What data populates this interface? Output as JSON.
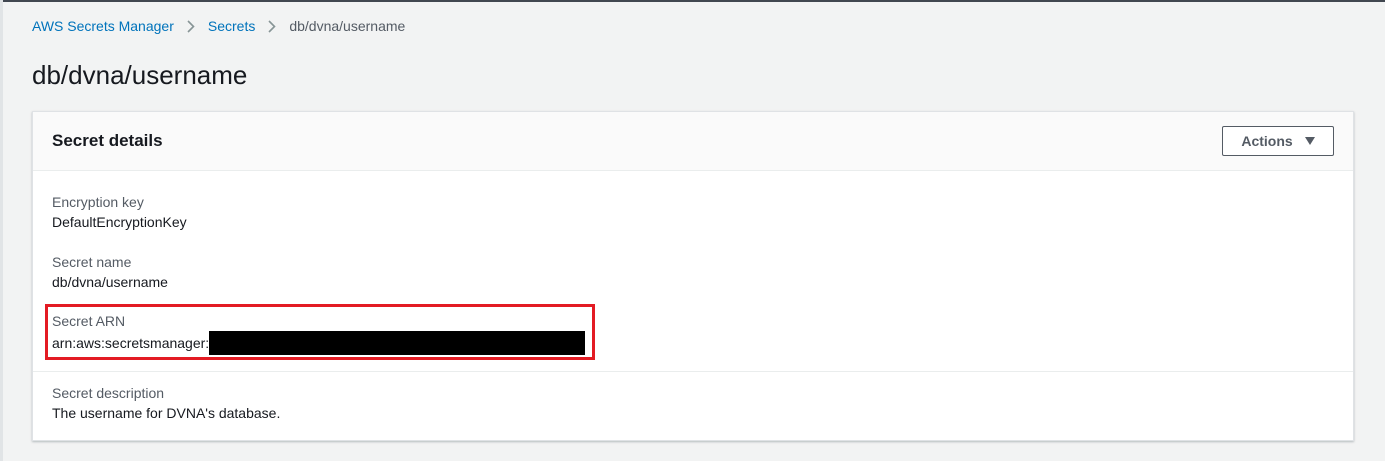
{
  "breadcrumb": {
    "items": [
      {
        "label": "AWS Secrets Manager"
      },
      {
        "label": "Secrets"
      },
      {
        "label": "db/dvna/username"
      }
    ],
    "separator_icon": "chevron-right-icon"
  },
  "page": {
    "title": "db/dvna/username"
  },
  "panel": {
    "title": "Secret details",
    "actions_label": "Actions",
    "actions_icon": "caret-down-icon"
  },
  "fields": {
    "encryption_key": {
      "label": "Encryption key",
      "value": "DefaultEncryptionKey"
    },
    "secret_name": {
      "label": "Secret name",
      "value": "db/dvna/username"
    },
    "secret_arn": {
      "label": "Secret ARN",
      "value_prefix": "arn:aws:secretsmanager:"
    },
    "secret_description": {
      "label": "Secret description",
      "value": "The username for DVNA's database."
    }
  },
  "colors": {
    "link": "#0073bb",
    "highlight": "#e31b23",
    "background": "#f2f3f3",
    "redaction": "#000000"
  }
}
